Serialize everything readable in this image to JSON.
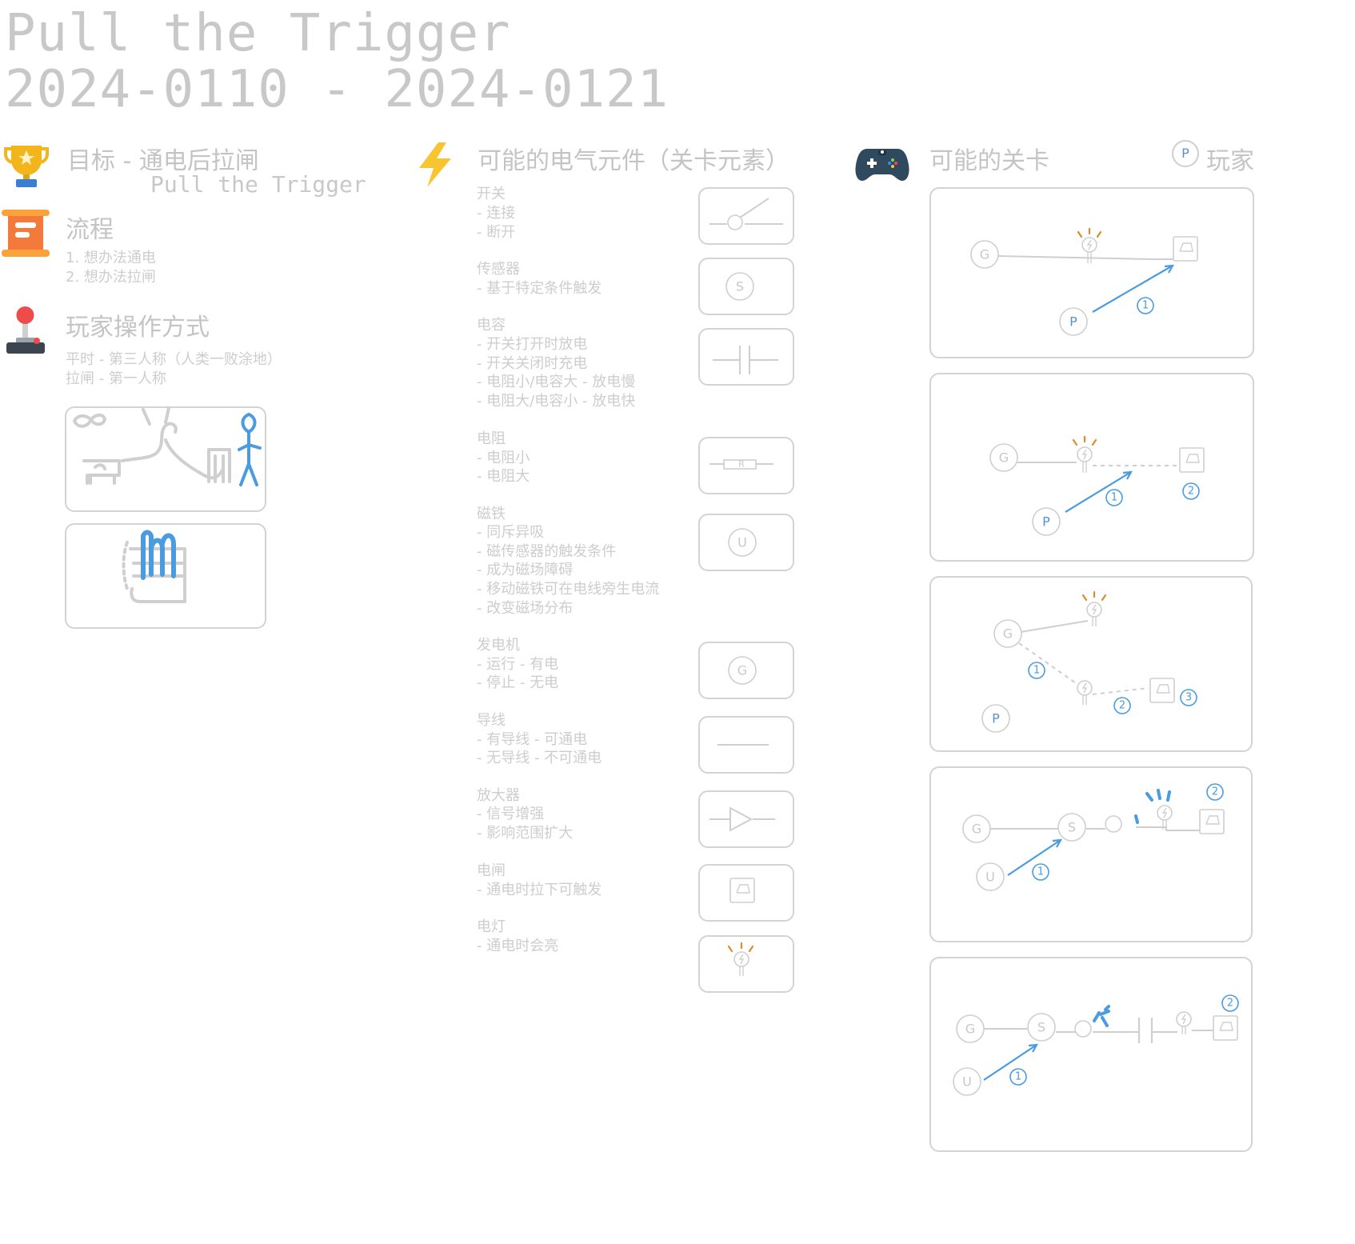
{
  "header": {
    "title": "Pull  the  Trigger",
    "dates": "2024-0110  -  2024-0121"
  },
  "goal": {
    "heading": "目标 - 通电后拉闸",
    "subheading": "Pull the Trigger"
  },
  "flow": {
    "heading": "流程",
    "steps": [
      "1. 想办法通电",
      "2. 想办法拉闸"
    ]
  },
  "controls": {
    "heading": "玩家操作方式",
    "lines": [
      "平时 - 第三人称（人类一败涂地）",
      "拉闸 - 第一人称"
    ]
  },
  "components": {
    "heading": "可能的电气元件（关卡元素）",
    "items": [
      {
        "name": "开关",
        "details": [
          "- 连接",
          "- 断开"
        ],
        "symbol": "switch"
      },
      {
        "name": "传感器",
        "details": [
          "- 基于特定条件触发"
        ],
        "symbol": "sensor",
        "symbol_text": "S"
      },
      {
        "name": "电容",
        "details": [
          "- 开关打开时放电",
          "- 开关关闭时充电",
          "- 电阻小/电容大 - 放电慢",
          "- 电阻大/电容小 - 放电快"
        ],
        "symbol": "capacitor"
      },
      {
        "name": "电阻",
        "details": [
          "- 电阻小",
          "- 电阻大"
        ],
        "symbol": "resistor",
        "symbol_text": "R"
      },
      {
        "name": "磁铁",
        "details": [
          "- 同斥异吸",
          "- 磁传感器的触发条件",
          "- 成为磁场障碍",
          "- 移动磁铁可在电线旁生电流",
          "- 改变磁场分布"
        ],
        "symbol": "magnet",
        "symbol_text": "U"
      },
      {
        "name": "发电机",
        "details": [
          "- 运行 - 有电",
          "- 停止 - 无电"
        ],
        "symbol": "generator",
        "symbol_text": "G"
      },
      {
        "name": "导线",
        "details": [
          "- 有导线 - 可通电",
          "- 无导线 - 不可通电"
        ],
        "symbol": "wire"
      },
      {
        "name": "放大器",
        "details": [
          "- 信号增强",
          "- 影响范围扩大"
        ],
        "symbol": "amplifier"
      },
      {
        "name": "电闸",
        "details": [
          "- 通电时拉下可触发"
        ],
        "symbol": "trigger"
      },
      {
        "name": "电灯",
        "details": [
          "- 通电时会亮"
        ],
        "symbol": "lamp"
      }
    ]
  },
  "levels": {
    "heading": "可能的关卡",
    "legend_badge": "P",
    "legend_label": "玩家",
    "node_labels": {
      "G": "G",
      "P": "P",
      "S": "S",
      "U": "U"
    },
    "step_numbers": [
      "①",
      "②",
      "③"
    ]
  },
  "colors": {
    "accent_blue": "#4a9be0",
    "light_gray": "#cfcfcf",
    "trophy_gold": "#f2b51c",
    "scroll_orange": "#f47a3b",
    "bolt_yellow": "#f7c531",
    "gamepad_navy": "#2f4a5e",
    "joystick_red": "#ee4b4b",
    "lamp_orange": "#e08a2a"
  },
  "icons": [
    "trophy-icon",
    "scroll-icon",
    "joystick-icon",
    "lightning-icon",
    "gamepad-icon"
  ]
}
